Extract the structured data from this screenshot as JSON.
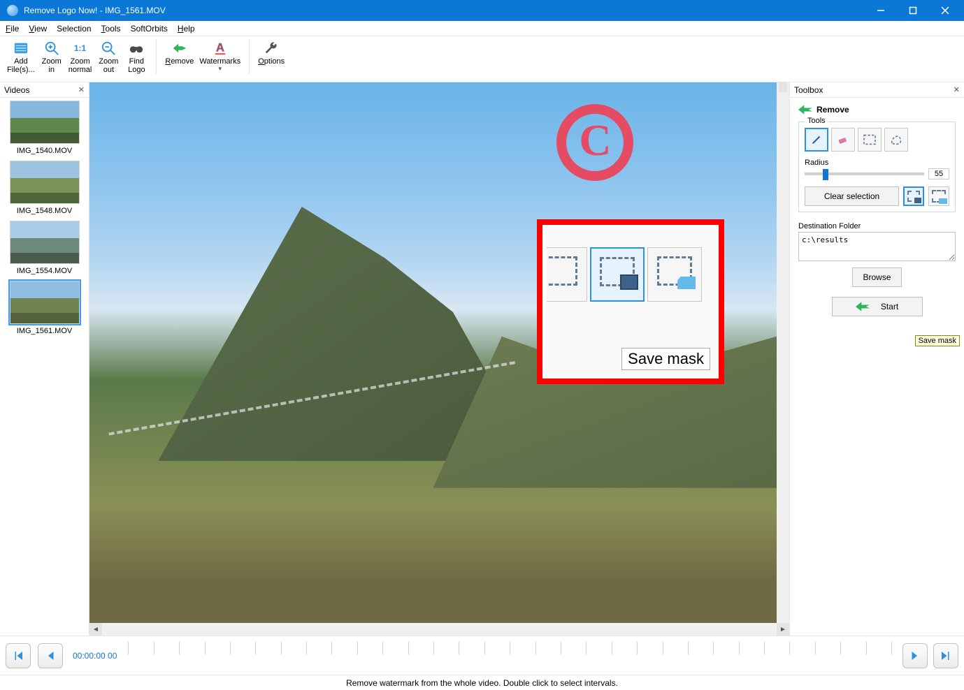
{
  "window": {
    "title": "Remove Logo Now! - IMG_1561.MOV"
  },
  "menu": {
    "file": "File",
    "view": "View",
    "selection": "Selection",
    "tools": "Tools",
    "softorbits": "SoftOrbits",
    "help": "Help"
  },
  "toolbar": {
    "add_files": "Add\nFile(s)...",
    "zoom_in": "Zoom\nin",
    "zoom_normal": "Zoom\nnormal",
    "zoom_out": "Zoom\nout",
    "find_logo": "Find\nLogo",
    "remove": "Remove",
    "watermarks": "Watermarks",
    "options": "Options",
    "zoom_11": "1:1"
  },
  "panels": {
    "videos": "Videos",
    "toolbox": "Toolbox"
  },
  "videos": [
    {
      "name": "IMG_1540.MOV",
      "colors": [
        "#87b6df",
        "#5d8a4a",
        "#3f5c33"
      ]
    },
    {
      "name": "IMG_1548.MOV",
      "colors": [
        "#9cc3e0",
        "#7a9458",
        "#4d6537"
      ]
    },
    {
      "name": "IMG_1554.MOV",
      "colors": [
        "#a9cde8",
        "#6e8a7a",
        "#4a5c4d"
      ]
    },
    {
      "name": "IMG_1561.MOV",
      "colors": [
        "#8fbde3",
        "#6f8350",
        "#55633c"
      ],
      "selected": true
    }
  ],
  "toolbox": {
    "section": "Remove",
    "tools_legend": "Tools",
    "radius_label": "Radius",
    "radius_value": "55",
    "clear_selection": "Clear selection",
    "dest_label": "Destination Folder",
    "dest_value": "c:\\results",
    "browse": "Browse",
    "start": "Start",
    "tooltip_save_mask": "Save mask"
  },
  "callout": {
    "save_mask_label": "Save mask"
  },
  "timeline": {
    "time": "00:00:00 00"
  },
  "statusbar": {
    "text": "Remove watermark from the whole video. Double click to select intervals."
  }
}
